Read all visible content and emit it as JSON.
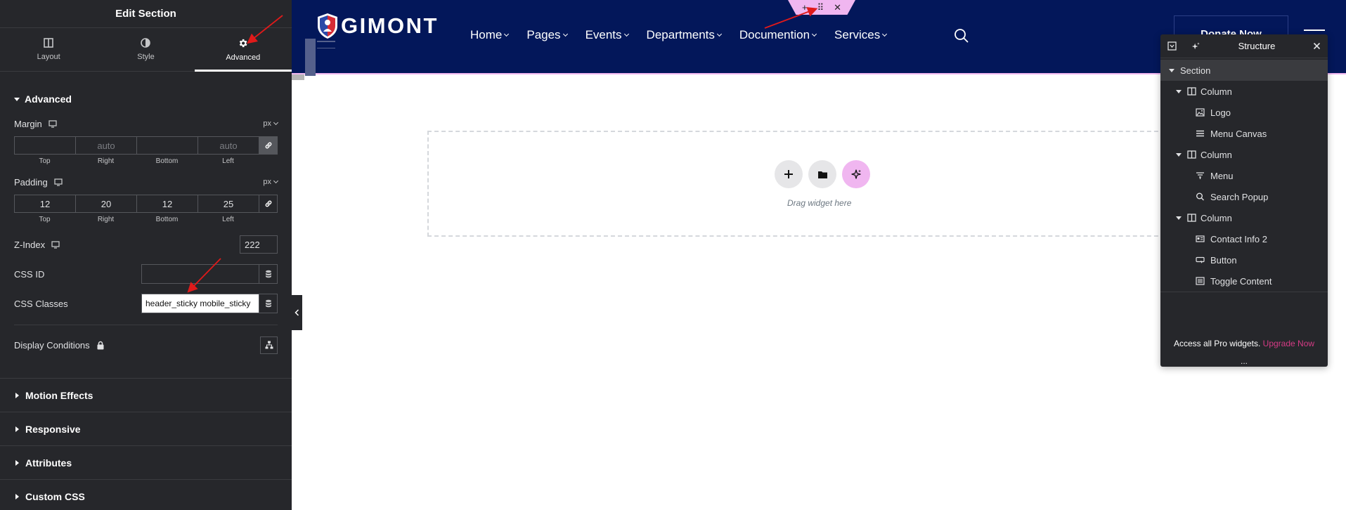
{
  "panel": {
    "title": "Edit Section",
    "tabs": [
      {
        "label": "Layout"
      },
      {
        "label": "Style"
      },
      {
        "label": "Advanced"
      }
    ],
    "advanced_title": "Advanced",
    "margin": {
      "label": "Margin",
      "unit": "px",
      "top": "",
      "right_placeholder": "auto",
      "bottom": "",
      "left_placeholder": "auto"
    },
    "padding": {
      "label": "Padding",
      "unit": "px",
      "top": "12",
      "right": "20",
      "bottom": "12",
      "left": "25"
    },
    "dim_labels": [
      "Top",
      "Right",
      "Bottom",
      "Left"
    ],
    "z_index": {
      "label": "Z-Index",
      "value": "222"
    },
    "css_id": {
      "label": "CSS ID",
      "value": ""
    },
    "css_classes": {
      "label": "CSS Classes",
      "value": "header_sticky mobile_sticky"
    },
    "display_conditions": "Display Conditions",
    "collapsed_sections": [
      "Motion Effects",
      "Responsive",
      "Attributes",
      "Custom CSS"
    ]
  },
  "site": {
    "logo_text": "GIMONT",
    "nav": [
      "Home",
      "Pages",
      "Events",
      "Departments",
      "Documention",
      "Services"
    ],
    "donate_label": "Donate Now"
  },
  "section_handle": {
    "add": "+",
    "move": "⠿",
    "close": "✕"
  },
  "canvas": {
    "drag_text": "Drag widget here"
  },
  "structure": {
    "title": "Structure",
    "items": [
      {
        "label": "Section",
        "level": "section"
      },
      {
        "label": "Column",
        "level": "column"
      },
      {
        "label": "Logo",
        "level": "widget",
        "icon": "image-icon"
      },
      {
        "label": "Menu Canvas",
        "level": "widget",
        "icon": "menu-lines-icon"
      },
      {
        "label": "Column",
        "level": "column"
      },
      {
        "label": "Menu",
        "level": "widget",
        "icon": "nav-menu-icon"
      },
      {
        "label": "Search Popup",
        "level": "widget",
        "icon": "search-icon"
      },
      {
        "label": "Column",
        "level": "column"
      },
      {
        "label": "Contact Info 2",
        "level": "widget",
        "icon": "contact-card-icon"
      },
      {
        "label": "Button",
        "level": "widget",
        "icon": "button-icon"
      },
      {
        "label": "Toggle Content",
        "level": "widget",
        "icon": "toggle-content-icon"
      }
    ],
    "promo_text": "Access all Pro widgets.",
    "promo_link": "Upgrade Now",
    "dots": "..."
  },
  "colors": {
    "panel_bg": "#26272b",
    "header_bg": "#03175a",
    "accent_pink": "#f0b6f0",
    "upgrade_link": "#d53b85"
  }
}
